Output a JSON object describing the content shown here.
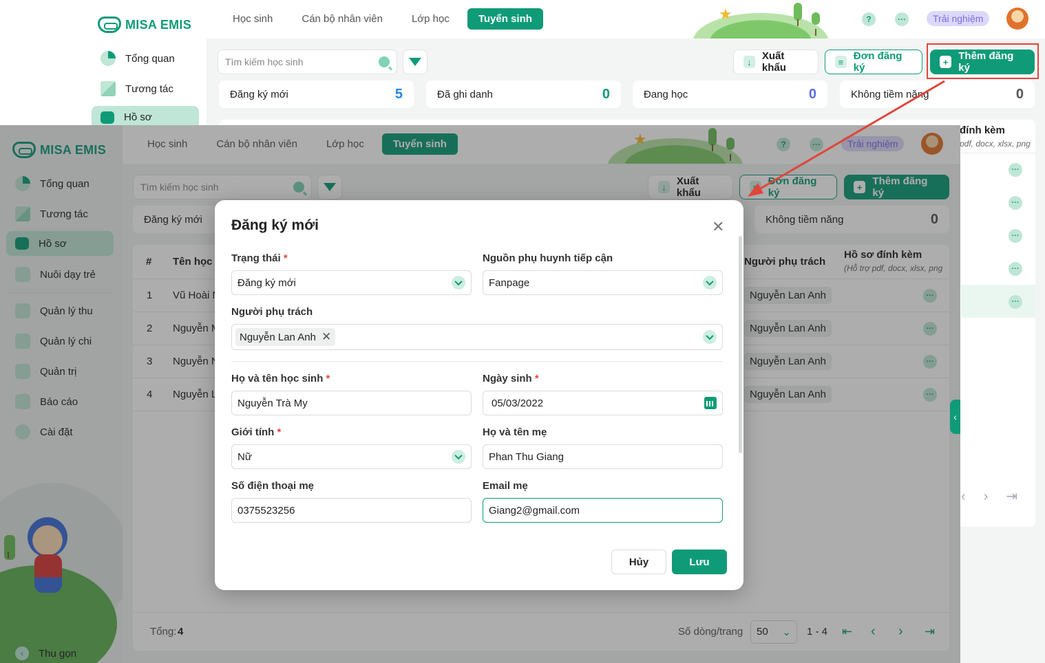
{
  "app": {
    "logo_text": "MISA EMIS"
  },
  "back": {
    "nav": [
      {
        "label": "Tổng quan"
      },
      {
        "label": "Tương tác"
      },
      {
        "label": "Hồ sơ"
      }
    ],
    "tabs": [
      {
        "label": "Học sinh"
      },
      {
        "label": "Cán bộ nhân viên"
      },
      {
        "label": "Lớp học"
      },
      {
        "label": "Tuyển sinh"
      }
    ],
    "help": "?",
    "more": "···",
    "trial": "Trải nghiệm",
    "search_placeholder": "Tìm kiếm học sinh",
    "btn_export": "Xuất khẩu",
    "btn_applications": "Đơn đăng ký",
    "btn_add": "Thêm đăng ký",
    "stats": [
      {
        "label": "Đăng ký mới",
        "value": "5"
      },
      {
        "label": "Đã ghi danh",
        "value": "0"
      },
      {
        "label": "Đang học",
        "value": "0"
      },
      {
        "label": "Không tiềm năng",
        "value": "0"
      }
    ],
    "col_attach": "đính kèm",
    "col_attach_sub": "pdf, docx, xlsx, png"
  },
  "front": {
    "nav": [
      {
        "label": "Tổng quan"
      },
      {
        "label": "Tương tác"
      },
      {
        "label": "Hồ sơ"
      },
      {
        "label": "Nuôi dạy trẻ"
      },
      {
        "label": "Quản lý thu"
      },
      {
        "label": "Quản lý chi"
      },
      {
        "label": "Quản trị"
      },
      {
        "label": "Báo cáo"
      },
      {
        "label": "Cài đặt"
      }
    ],
    "collapse": "Thu gọn",
    "tabs": [
      {
        "label": "Học sinh"
      },
      {
        "label": "Cán bộ nhân viên"
      },
      {
        "label": "Lớp học"
      },
      {
        "label": "Tuyển sinh"
      }
    ],
    "help": "?",
    "more": "···",
    "trial": "Trải nghiệm",
    "search_placeholder": "Tìm kiếm học sinh",
    "btn_export": "Xuất khẩu",
    "btn_applications": "Đơn đăng ký",
    "btn_add": "Thêm đăng ký",
    "stat_first": "Đăng ký mới",
    "stat_last": {
      "label": "Không tiềm năng",
      "value": "0"
    },
    "table": {
      "headers": {
        "idx": "#",
        "name": "Tên học s",
        "owner": "Người phụ trách",
        "attach": "Hồ sơ đính kèm",
        "attach_sub": "(Hỗ trợ pdf, docx, xlsx, png"
      },
      "rows": [
        {
          "idx": "1",
          "name": "Vũ Hoài N",
          "owner": "Nguyễn Lan Anh"
        },
        {
          "idx": "2",
          "name": "Nguyễn M",
          "owner": "Nguyễn Lan Anh"
        },
        {
          "idx": "3",
          "name": "Nguyễn N",
          "owner": "Nguyễn Lan Anh"
        },
        {
          "idx": "4",
          "name": "Nguyễn L",
          "owner": "Nguyễn Lan Anh"
        }
      ]
    },
    "footer": {
      "total_label": "Tổng:",
      "total": "4",
      "rows_per_page_label": "Số dòng/trang",
      "rows_per_page": "50",
      "range": "1 - 4"
    }
  },
  "modal": {
    "title": "Đăng ký mới",
    "status_label": "Trạng thái",
    "status_value": "Đăng ký mới",
    "source_label": "Nguồn phụ huynh tiếp cận",
    "source_value": "Fanpage",
    "owner_label": "Người phụ trách",
    "owner_tag": "Nguyễn Lan Anh",
    "name_label": "Họ và tên học sinh",
    "name_value": "Nguyễn Trà My",
    "dob_label": "Ngày sinh",
    "dob_value": "05/03/2022",
    "gender_label": "Giới tính",
    "gender_value": "Nữ",
    "mother_label": "Họ và tên mẹ",
    "mother_value": "Phan Thu Giang",
    "phone_label": "Số điện thoại mẹ",
    "phone_value": "0375523256",
    "email_label": "Email mẹ",
    "email_value": "Giang2@gmail.com",
    "cancel": "Hủy",
    "save": "Lưu",
    "required_mark": "*"
  },
  "colors": {
    "brand": "#0f9b78",
    "highlight": "#e0463b",
    "trial": "#7c6be0"
  }
}
